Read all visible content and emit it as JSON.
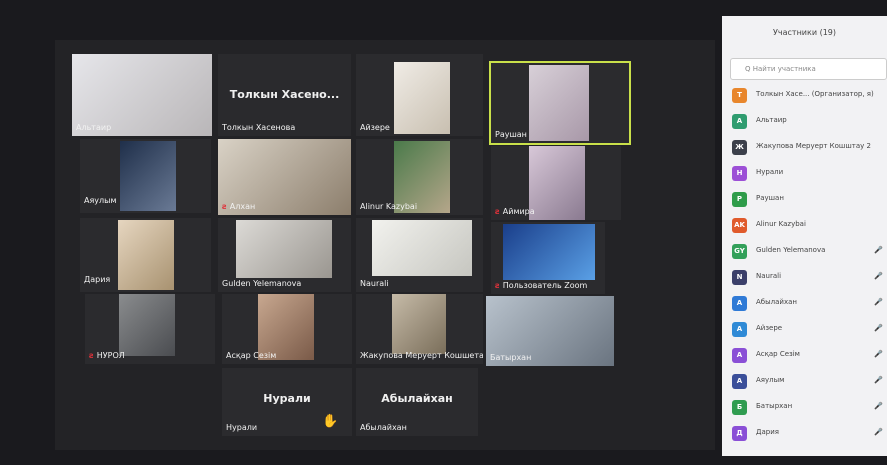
{
  "participants_panel": {
    "title": "Участники (19)",
    "search_placeholder": "Q Найти участника",
    "items": [
      {
        "initial": "T",
        "label": "Толкын Хасе... (Организатор, я)",
        "color": "#e8862c"
      },
      {
        "initial": "А",
        "label": "Альтаир",
        "color": "#2f9c70"
      },
      {
        "initial": "Ж",
        "label": "Жакупова Меруерт Кошштау 2",
        "color": "#3b3f4a"
      },
      {
        "initial": "Н",
        "label": "Нурали",
        "color": "#9c4fd6"
      },
      {
        "initial": "Р",
        "label": "Раушан",
        "color": "#2f9c4a"
      },
      {
        "initial": "AK",
        "label": "Alinur Kazybai",
        "color": "#e05a2b"
      },
      {
        "initial": "GY",
        "label": "Gulden Yelemanova",
        "color": "#33a05a"
      },
      {
        "initial": "N",
        "label": "Naurali",
        "color": "#3b3f6a"
      },
      {
        "initial": "А",
        "label": "Абылайхан",
        "color": "#2f7ad6"
      },
      {
        "initial": "А",
        "label": "Айзере",
        "color": "#2f8ad6"
      },
      {
        "initial": "А",
        "label": "Асқар Сезім",
        "color": "#8a4fd6"
      },
      {
        "initial": "А",
        "label": "Аяулым",
        "color": "#3b4f9a"
      },
      {
        "initial": "Б",
        "label": "Батырхан",
        "color": "#2f9c50"
      },
      {
        "initial": "Д",
        "label": "Дария",
        "color": "#8a4fd6"
      }
    ]
  },
  "tiles": {
    "t1": {
      "name": "Альтаир"
    },
    "t2": {
      "name": "Толкын Хасенова",
      "big": "Толкын Хасено..."
    },
    "t3": {
      "name": "Айзере"
    },
    "t4": {
      "name": "Раушан"
    },
    "t5": {
      "name": "Аяулым"
    },
    "t6": {
      "name": "Алхан"
    },
    "t7": {
      "name": "Alinur Kazybai"
    },
    "t8": {
      "name": "Аймира"
    },
    "t9": {
      "name": "Дария"
    },
    "t10": {
      "name": "Gulden Yelemanova"
    },
    "t11": {
      "name": "Naurali"
    },
    "t12": {
      "name": "Пользователь Zoom"
    },
    "t13": {
      "name": "НУРОЛ"
    },
    "t14": {
      "name": "Асқар Сезім"
    },
    "t15": {
      "name": "Жакупова Меруерт Кошшета..."
    },
    "t16": {
      "name": "Батырхан"
    },
    "t17": {
      "name": "Нурали",
      "big": "Нурали"
    },
    "t18": {
      "name": "Абылайхан",
      "big": "Абылайхан"
    }
  },
  "icons": {
    "hand": "raised-hand-icon"
  }
}
